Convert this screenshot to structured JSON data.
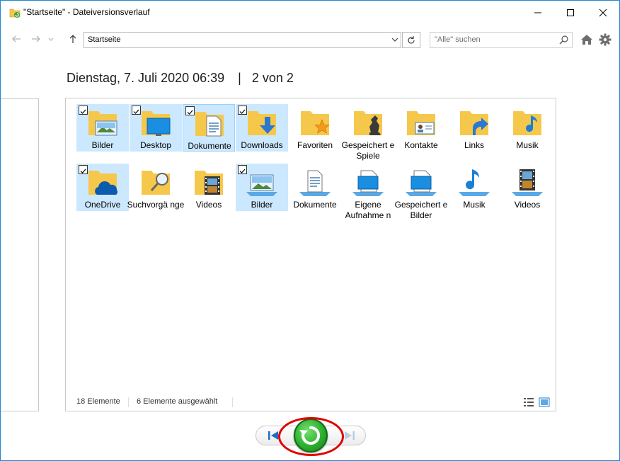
{
  "window": {
    "title": "\"Startseite\" - Dateiversionsverlauf"
  },
  "navigation": {
    "address": "Startseite",
    "search_placeholder": "\"Alle\" suchen"
  },
  "header": {
    "date": "Dienstag, 7. Juli 2020 06:39",
    "separator": "|",
    "position": "2 von 2"
  },
  "items": [
    {
      "label": "Bilder",
      "icon": "pictures-folder-icon",
      "checked": true
    },
    {
      "label": "Desktop",
      "icon": "desktop-folder-icon",
      "checked": true
    },
    {
      "label": "Dokumente",
      "icon": "documents-folder-icon",
      "checked": true
    },
    {
      "label": "Downloads",
      "icon": "downloads-folder-icon",
      "checked": true
    },
    {
      "label": "Favoriten",
      "icon": "favorites-folder-icon",
      "checked": false
    },
    {
      "label": "Gespeichert e Spiele",
      "icon": "saved-games-folder-icon",
      "checked": false
    },
    {
      "label": "Kontakte",
      "icon": "contacts-folder-icon",
      "checked": false
    },
    {
      "label": "Links",
      "icon": "links-folder-icon",
      "checked": false
    },
    {
      "label": "Musik",
      "icon": "music-folder-icon",
      "checked": false
    },
    {
      "label": "OneDrive",
      "icon": "onedrive-folder-icon",
      "checked": true
    },
    {
      "label": "Suchvorgä nge",
      "icon": "searches-folder-icon",
      "checked": false
    },
    {
      "label": "Videos",
      "icon": "videos-folder-icon",
      "checked": false
    },
    {
      "label": "Bilder",
      "icon": "pictures-library-icon",
      "checked": true
    },
    {
      "label": "Dokumente",
      "icon": "documents-library-icon",
      "checked": false
    },
    {
      "label": "Eigene Aufnahme n",
      "icon": "camera-roll-library-icon",
      "checked": false
    },
    {
      "label": "Gespeichert e Bilder",
      "icon": "saved-pictures-library-icon",
      "checked": false
    },
    {
      "label": "Musik",
      "icon": "music-library-icon",
      "checked": false
    },
    {
      "label": "Videos",
      "icon": "videos-library-icon",
      "checked": false
    }
  ],
  "status": {
    "count": "18 Elemente",
    "selected": "6 Elemente ausgewählt"
  },
  "colors": {
    "selection": "#cce8ff",
    "folder": "#f5c84c",
    "accent": "#1e88d6",
    "restore_green": "#2eaf2e",
    "highlight_ring": "#e10000"
  }
}
